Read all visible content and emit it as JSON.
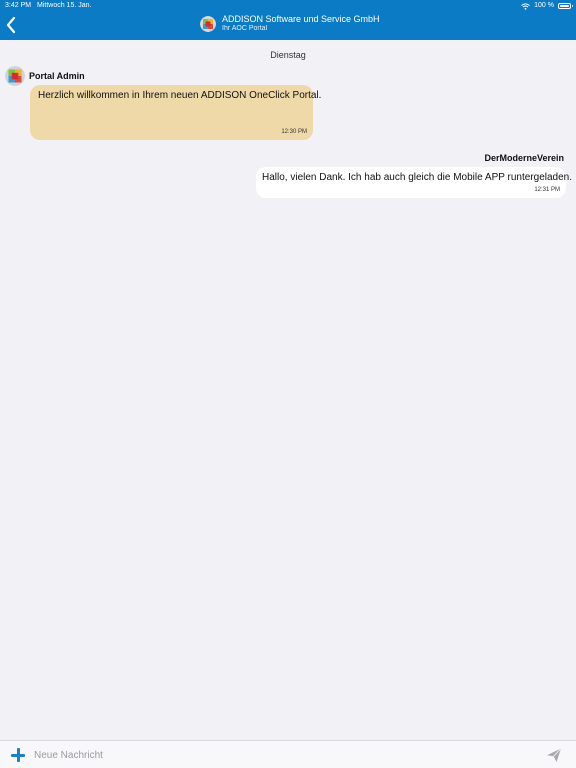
{
  "status_bar": {
    "time": "3:42 PM",
    "date": "Mittwoch 15. Jan.",
    "battery": "100 %",
    "battery_level": 1.0
  },
  "header": {
    "title": "ADDISON Software und Service GmbH",
    "subtitle": "Ihr AOC Portal",
    "back_icon": "chevron-left-icon",
    "accent_color": "#0a7bc4"
  },
  "conversation": {
    "day_label": "Dienstag",
    "messages": [
      {
        "sender": "Portal Admin",
        "text": "Herzlich willkommen in Ihrem neuen ADDISON OneClick Portal.",
        "time": "12:30 PM",
        "direction": "incoming",
        "bubble_color": "#f0d9a9"
      },
      {
        "sender": "DerModerneVerein",
        "text": "Hallo, vielen Dank. Ich hab auch gleich die Mobile APP runtergeladen.",
        "time": "12:31 PM",
        "direction": "outgoing",
        "bubble_color": "#ffffff"
      }
    ]
  },
  "composer": {
    "placeholder": "Neue Nachricht",
    "value": "",
    "add_icon": "plus-icon",
    "send_icon": "paper-plane-icon"
  }
}
